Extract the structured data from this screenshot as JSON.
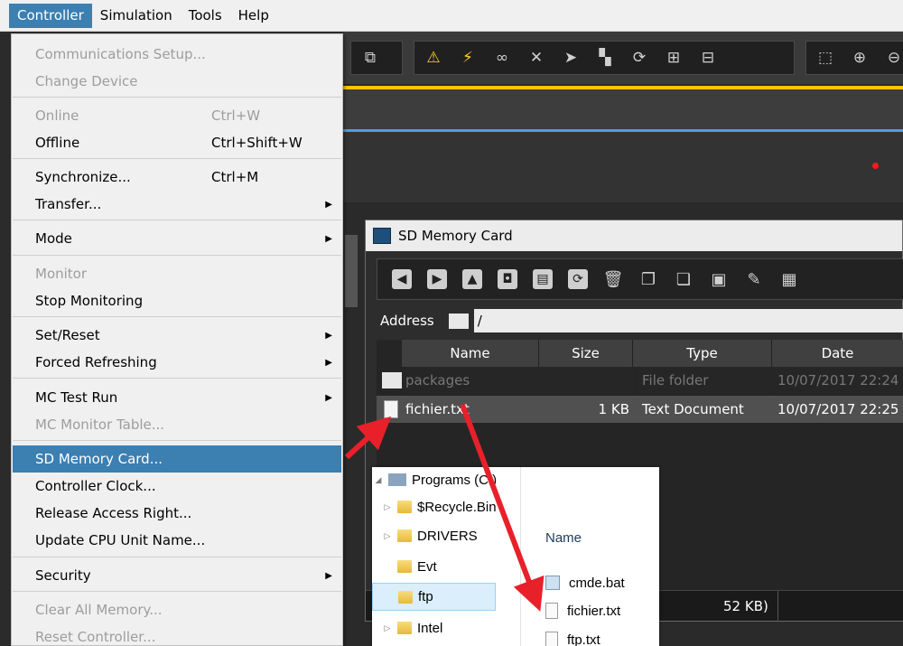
{
  "menubar": {
    "items": [
      "Controller",
      "Simulation",
      "Tools",
      "Help"
    ],
    "active": "Controller"
  },
  "controller_menu": {
    "items": [
      {
        "label": "Communications Setup...",
        "shortcut": "",
        "submenu": false,
        "disabled": true
      },
      {
        "label": "Change Device",
        "shortcut": "",
        "submenu": false,
        "disabled": true
      },
      {
        "label": "Online",
        "shortcut": "Ctrl+W",
        "submenu": false,
        "disabled": true
      },
      {
        "label": "Offline",
        "shortcut": "Ctrl+Shift+W",
        "submenu": false,
        "disabled": false
      },
      {
        "label": "Synchronize...",
        "shortcut": "Ctrl+M",
        "submenu": false,
        "disabled": false
      },
      {
        "label": "Transfer...",
        "shortcut": "",
        "submenu": true,
        "disabled": false
      },
      {
        "label": "Mode",
        "shortcut": "",
        "submenu": true,
        "disabled": false
      },
      {
        "label": "Monitor",
        "shortcut": "",
        "submenu": false,
        "disabled": true
      },
      {
        "label": "Stop Monitoring",
        "shortcut": "",
        "submenu": false,
        "disabled": false
      },
      {
        "label": "Set/Reset",
        "shortcut": "",
        "submenu": true,
        "disabled": false
      },
      {
        "label": "Forced Refreshing",
        "shortcut": "",
        "submenu": true,
        "disabled": false
      },
      {
        "label": "MC Test Run",
        "shortcut": "",
        "submenu": true,
        "disabled": false
      },
      {
        "label": "MC Monitor Table...",
        "shortcut": "",
        "submenu": false,
        "disabled": true
      },
      {
        "label": "SD Memory Card...",
        "shortcut": "",
        "submenu": false,
        "disabled": false,
        "highlighted": true
      },
      {
        "label": "Controller Clock...",
        "shortcut": "",
        "submenu": false,
        "disabled": false
      },
      {
        "label": "Release Access Right...",
        "shortcut": "",
        "submenu": false,
        "disabled": false
      },
      {
        "label": "Update CPU Unit Name...",
        "shortcut": "",
        "submenu": false,
        "disabled": false
      },
      {
        "label": "Security",
        "shortcut": "",
        "submenu": true,
        "disabled": false
      },
      {
        "label": "Clear All Memory...",
        "shortcut": "",
        "submenu": false,
        "disabled": true
      },
      {
        "label": "Reset Controller...",
        "shortcut": "",
        "submenu": false,
        "disabled": true
      }
    ]
  },
  "sd_window": {
    "title": "SD Memory Card",
    "address_label": "Address",
    "address_value": "/",
    "columns": [
      "Name",
      "Size",
      "Type",
      "Date"
    ],
    "rows": [
      {
        "name": "packages",
        "size": "",
        "type": "File folder",
        "date": "10/07/2017 22:24"
      },
      {
        "name": "fichier.txt",
        "size": "1 KB",
        "type": "Text Document",
        "date": "10/07/2017 22:25"
      }
    ],
    "status_text": "52 KB)"
  },
  "explorer": {
    "tree": [
      {
        "label": "Programs (C:)",
        "expander": "◢"
      },
      {
        "label": "$Recycle.Bin",
        "expander": "▷"
      },
      {
        "label": "DRIVERS",
        "expander": "▷"
      },
      {
        "label": "Evt",
        "expander": ""
      },
      {
        "label": "ftp",
        "expander": "",
        "selected": true
      },
      {
        "label": "Intel",
        "expander": "▷"
      }
    ],
    "column_header": "Name",
    "files": [
      "cmde.bat",
      "fichier.txt",
      "ftp.txt"
    ]
  },
  "colors": {
    "menu_highlight": "#3c7fb1",
    "arrow_red": "#e8202a",
    "toolbar_accent_yellow": "#ffc400",
    "accent_blue": "#4f9be0"
  }
}
